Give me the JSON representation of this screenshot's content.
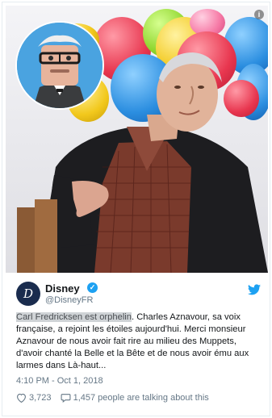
{
  "photo": {
    "info_label": "i"
  },
  "tweet": {
    "author_name": "Disney",
    "author_handle": "@DisneyFR",
    "logo_letter": "D",
    "highlight_text": "Carl Fredricksen est orphelin",
    "body_text": ". Charles Aznavour, sa voix française, a rejoint les étoiles aujourd'hui. Merci monsieur Aznavour de nous avoir fait rire au milieu des Muppets, d'avoir chanté la Belle et la Bête et de nous avoir ému aux larmes dans Là-haut...",
    "timestamp": "4:10 PM - Oct 1, 2018",
    "likes": "3,723",
    "talking": "1,457 people are talking about this"
  },
  "colors": {
    "twitter_blue": "#1da1f2",
    "text": "#14171a",
    "muted": "#657786"
  },
  "icons": [
    "info-icon",
    "disney-logo",
    "verified-icon",
    "twitter-bird-icon",
    "heart-icon",
    "comment-icon"
  ]
}
